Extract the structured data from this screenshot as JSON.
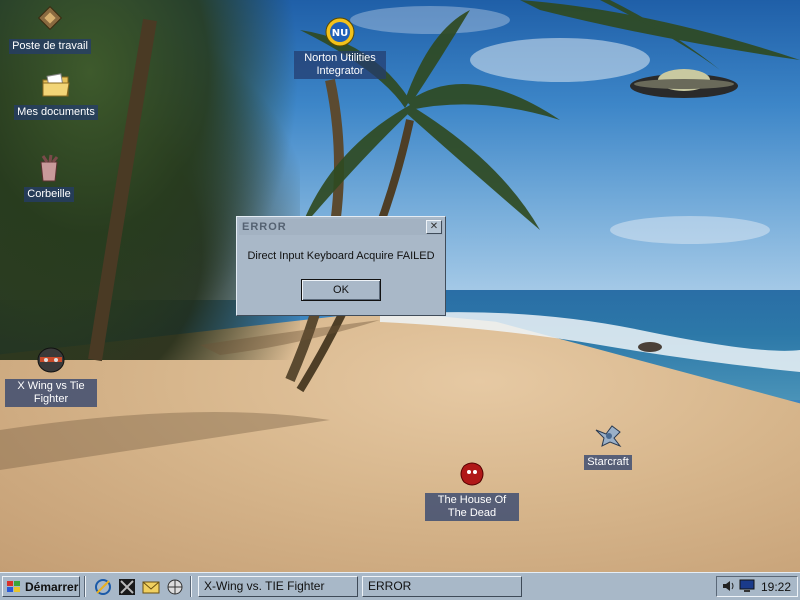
{
  "desktop": {
    "icons": [
      {
        "label": "Poste de travail",
        "icon": "computer-icon"
      },
      {
        "label": "Mes documents",
        "icon": "folder-icon"
      },
      {
        "label": "Corbeille",
        "icon": "recycle-bin-icon"
      },
      {
        "label": "Norton Utilities Integrator",
        "icon": "norton-utilities-icon"
      },
      {
        "label": "X Wing vs Tie Fighter",
        "icon": "xwing-helmet-icon"
      },
      {
        "label": "Starcraft",
        "icon": "starcraft-ship-icon"
      },
      {
        "label": "The House Of The Dead",
        "icon": "house-of-the-dead-icon"
      }
    ],
    "wallpaper": "tropical-beach-with-palm-trees-and-ufo"
  },
  "dialog": {
    "title": "ERROR",
    "message": "Direct Input Keyboard Acquire FAILED",
    "ok_label": "OK",
    "close_glyph": "✕"
  },
  "taskbar": {
    "start_label": "Démarrer",
    "quick_launch": [
      "internet-explorer-icon",
      "xwing-launcher-icon",
      "outlook-express-icon",
      "show-desktop-icon"
    ],
    "tasks": [
      {
        "label": "X-Wing vs. TIE Fighter",
        "active": false
      },
      {
        "label": "ERROR",
        "active": true
      }
    ],
    "clock": "19:22",
    "tray_icons": [
      "volume-icon",
      "display-icon"
    ]
  },
  "colors": {
    "taskbar": "#a8b8c8",
    "dialog": "#a9b8c8",
    "icon_label_bg": "#243c6e"
  }
}
